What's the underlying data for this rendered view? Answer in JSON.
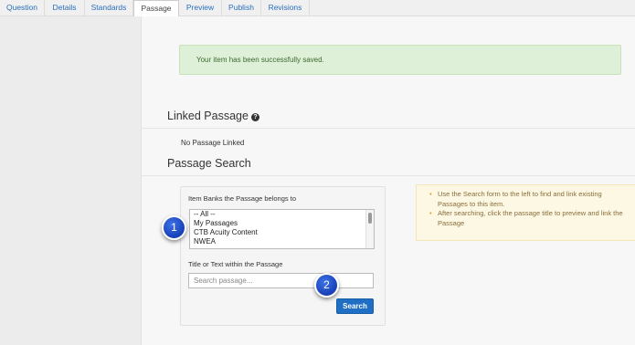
{
  "tabs": [
    {
      "label": "Question",
      "active": false
    },
    {
      "label": "Details",
      "active": false
    },
    {
      "label": "Standards",
      "active": false
    },
    {
      "label": "Passage",
      "active": true
    },
    {
      "label": "Preview",
      "active": false
    },
    {
      "label": "Publish",
      "active": false
    },
    {
      "label": "Revisions",
      "active": false
    }
  ],
  "alert": {
    "text": "Your item has been successfully saved."
  },
  "linked": {
    "heading": "Linked Passage",
    "help_icon": "question-circle-icon",
    "empty_text": "No Passage Linked"
  },
  "search": {
    "heading": "Passage Search",
    "banks_label": "Item Banks the Passage belongs to",
    "banks_options": [
      "-- All --",
      "My Passages",
      "CTB Acuity Content",
      "NWEA"
    ],
    "title_label": "Title or Text within the Passage",
    "input_value": "",
    "input_placeholder": "Search passage...",
    "button_label": "Search"
  },
  "help_notes": [
    "Use the Search form to the left to find and link existing Passages to this item.",
    "After searching, click the passage title to preview and link the Passage"
  ],
  "callouts": [
    "1",
    "2"
  ]
}
